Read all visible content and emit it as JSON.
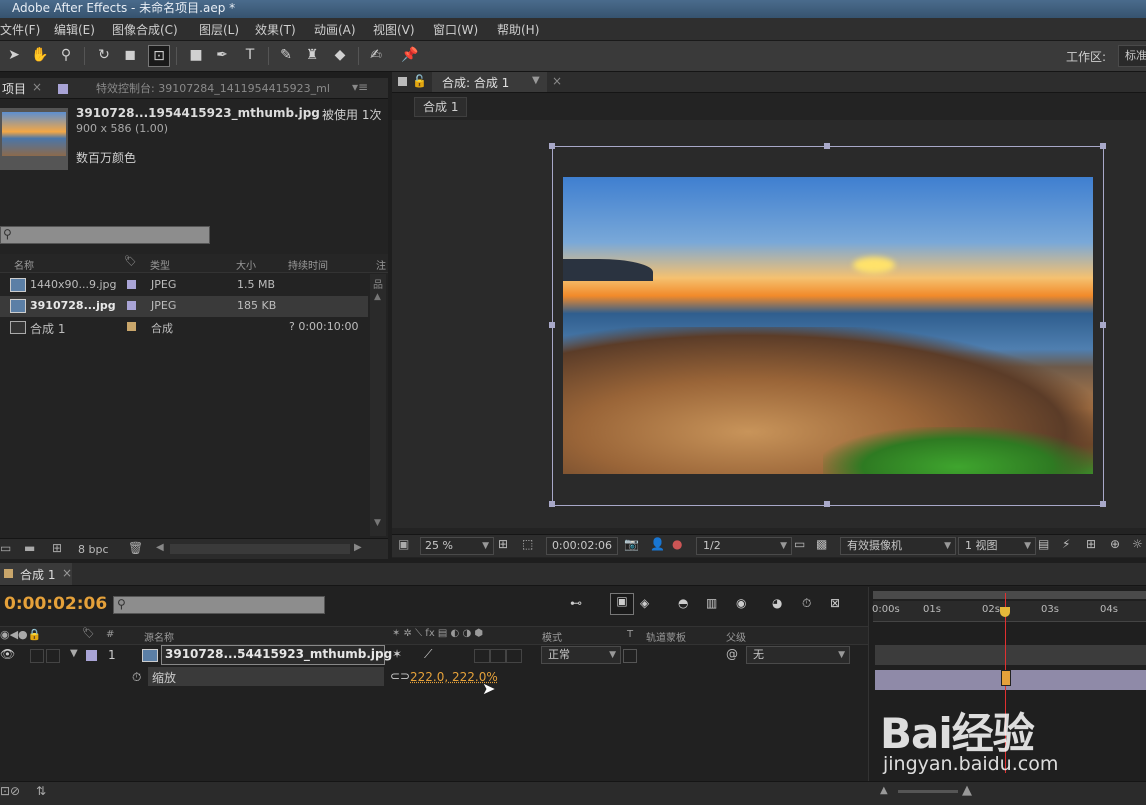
{
  "title": "Adobe After Effects - 未命名项目.aep *",
  "menu": [
    "文件(F)",
    "编辑(E)",
    "图像合成(C)",
    "图层(L)",
    "效果(T)",
    "动画(A)",
    "视图(V)",
    "窗口(W)",
    "帮助(H)"
  ],
  "toolbar": {
    "workspace_label": "工作区:",
    "workspace_value": "标准",
    "tools": [
      "selection-icon",
      "hand-icon",
      "zoom-icon",
      "rotate-icon",
      "camera-icon",
      "pan-behind-icon",
      "rectangle-icon",
      "pen-icon",
      "text-icon",
      "brush-icon",
      "clone-stamp-icon",
      "eraser-icon",
      "roto-brush-icon",
      "puppet-pin-icon"
    ]
  },
  "project_panel": {
    "tab_label": "项目",
    "effects_tab": "特效控制台: 39107284_1411954415923_ml",
    "file_name": "3910728...1954415923_mthumb.jpg",
    "used_count": "被使用 1次",
    "dimensions": "900 x 586 (1.00)",
    "color_depth": "数百万颜色",
    "search_placeholder": "",
    "columns": {
      "name": "名称",
      "type": "类型",
      "size": "大小",
      "duration": "持续时间",
      "extra": "注"
    },
    "items": [
      {
        "name": "1440x90...9.jpg",
        "type": "JPEG",
        "size": "1.5 MB",
        "duration": "",
        "color": "#a9a4d6"
      },
      {
        "name": "3910728...jpg",
        "type": "JPEG",
        "size": "185 KB",
        "duration": "",
        "color": "#a9a4d6"
      },
      {
        "name": "合成 1",
        "type": "合成",
        "size": "",
        "duration": "? 0:00:10:00",
        "color": "#c9a66b"
      }
    ],
    "bpc": "8 bpc"
  },
  "composition_panel": {
    "tab_label": "合成: 合成 1",
    "breadcrumb": "合成 1",
    "zoom": "25 %",
    "timecode": "0:00:02:06",
    "resolution": "1/2",
    "camera": "有效摄像机",
    "views": "1 视图"
  },
  "timeline": {
    "tab_label": "合成 1",
    "timecode": "0:00:02:06",
    "columns": {
      "source_name": "源名称",
      "mode": "模式",
      "t": "T",
      "track_matte": "轨道蒙板",
      "parent": "父级"
    },
    "layer": {
      "index": "1",
      "name": "3910728...54415923_mthumb.jpg",
      "mode": "正常",
      "parent": "无"
    },
    "property": {
      "name": "缩放",
      "value": "222.0, 222.0%"
    },
    "ruler": [
      "0:00s",
      "01s",
      "02s",
      "03s",
      "04s"
    ],
    "playhead_seconds": 2.25
  },
  "watermark": {
    "brand": "Bai经验",
    "url": "jingyan.baidu.com"
  }
}
